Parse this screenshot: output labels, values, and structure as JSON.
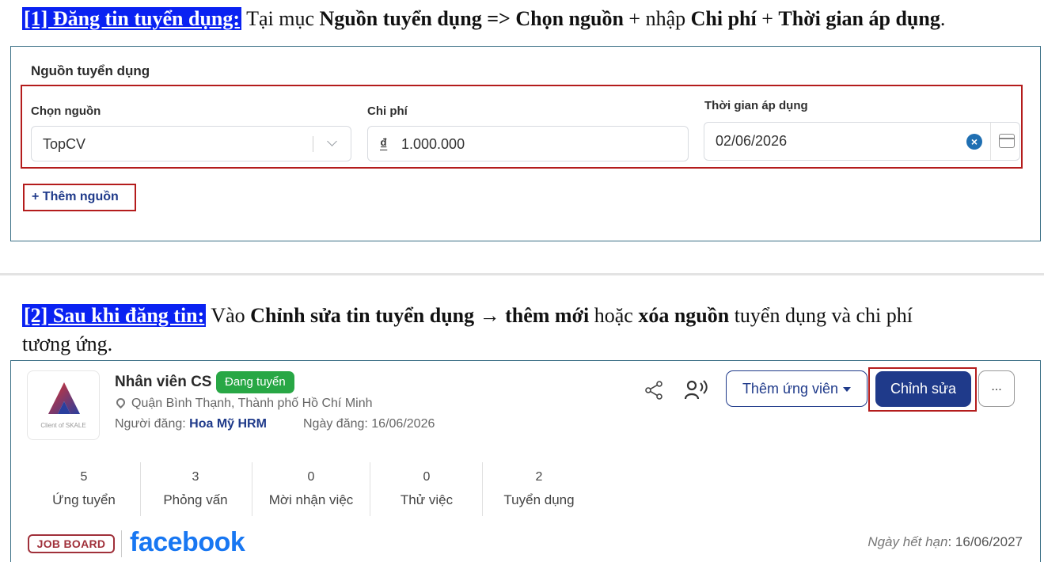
{
  "step1": {
    "tag": "[1] Đăng tin tuyển dụng:",
    "text1": " Tại mục ",
    "bold1": "Nguồn tuyển dụng => Chọn nguồn",
    "text2": " + nhập ",
    "bold2": "Chi phí",
    "text3": " + ",
    "bold3": "Thời gian áp dụng",
    "text4": "."
  },
  "source_form": {
    "title": "Nguồn tuyển dụng",
    "source_label": "Chọn nguồn",
    "source_value": "TopCV",
    "cost_label": "Chi phí",
    "currency_symbol": "₫",
    "cost_value": "1.000.000",
    "date_label": "Thời gian áp dụng",
    "date_value": "02/06/2026",
    "clear_symbol": "×",
    "add_source": "+ Thêm nguồn"
  },
  "step2": {
    "tag": "[2] Sau khi đăng tin:",
    "text1": " Vào ",
    "bold1": "Chỉnh sửa tin tuyển dụng → thêm mới",
    "text2": " hoặc ",
    "bold2": "xóa nguồn",
    "text3": " tuyển dụng và chi phí",
    "line2": "tương ứng."
  },
  "job": {
    "logo_caption": "Client of SKALE",
    "title": "Nhân viên CS",
    "status": "Đang tuyển",
    "location": "Quận Bình Thạnh, Thành phố Hồ Chí Minh",
    "poster_label": "Người đăng: ",
    "poster_name": "Hoa Mỹ HRM",
    "post_date": "Ngày đăng: 16/06/2026",
    "add_candidate": "Thêm ứng viên",
    "edit": "Chỉnh sửa",
    "more": "...",
    "stats": [
      {
        "value": "5",
        "label": "Ứng tuyển"
      },
      {
        "value": "3",
        "label": "Phỏng vấn"
      },
      {
        "value": "0",
        "label": "Mời nhận việc"
      },
      {
        "value": "0",
        "label": "Thử việc"
      },
      {
        "value": "2",
        "label": "Tuyển dụng"
      }
    ],
    "jobboard": "JOB BOARD",
    "facebook": "facebook",
    "expiry_label": "Ngày hết hạn",
    "expiry_value": ": 16/06/2027"
  },
  "colors": {
    "accent": "#1f3a8a",
    "highlight": "#0a22f2",
    "annotation_red": "#b41c1c",
    "status_green": "#28a745",
    "facebook_blue": "#1877f2"
  },
  "icons": [
    "chevron-down-icon",
    "clear-icon",
    "calendar-icon",
    "location-pin-icon",
    "share-icon",
    "voice-icon",
    "caret-down-icon"
  ]
}
